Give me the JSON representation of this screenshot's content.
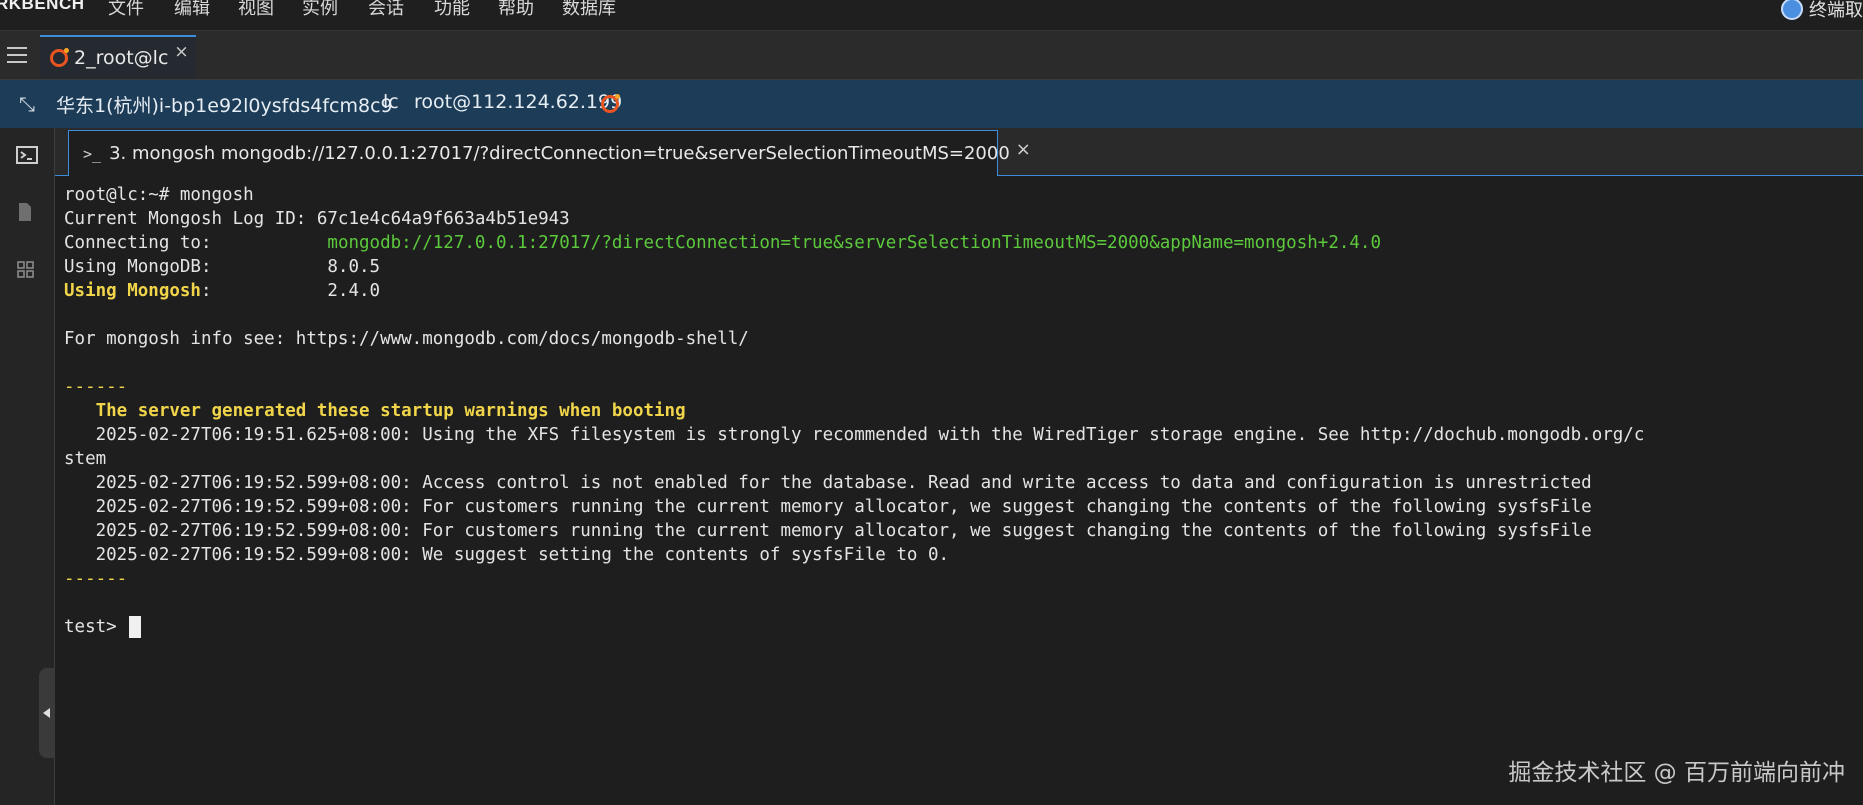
{
  "menubar": {
    "brand": "RKBENCH",
    "items": [
      "文件",
      "编辑",
      "视图",
      "实例",
      "会话",
      "功能",
      "帮助",
      "数据库"
    ],
    "right_label": "终端取"
  },
  "session_tab": {
    "label": "2_root@lc",
    "close": "×"
  },
  "infobar": {
    "instance": "华东1(杭州)i-bp1e92l0ysfds4fcm8c9",
    "host": "lc",
    "user": "root@112.124.62.199"
  },
  "terminal_tab": {
    "prompt_icon": ">_",
    "label": "3. mongosh mongodb://127.0.0.1:27017/?directConnection=true&serverSelectionTimeoutMS=2000",
    "close": "×"
  },
  "terminal": {
    "cmd": "root@lc:~# mongosh",
    "log_id": "Current Mongosh Log ID: 67c1e4c64a9f663a4b51e943",
    "connecting_label": "Connecting to:           ",
    "connecting_value": "mongodb://127.0.0.1:27017/?directConnection=true&serverSelectionTimeoutMS=2000&appName=mongosh+2.4.0",
    "using_mongodb": "Using MongoDB:           8.0.5",
    "using_mongosh_label": "Using Mongosh",
    "using_mongosh_value": ":           2.4.0",
    "info": "For mongosh info see: https://www.mongodb.com/docs/mongodb-shell/",
    "separator": "------",
    "warning_header": "   The server generated these startup warnings when booting",
    "warnings": [
      "   2025-02-27T06:19:51.625+08:00: Using the XFS filesystem is strongly recommended with the WiredTiger storage engine. See http://dochub.mongodb.org/c",
      "stem",
      "   2025-02-27T06:19:52.599+08:00: Access control is not enabled for the database. Read and write access to data and configuration is unrestricted",
      "   2025-02-27T06:19:52.599+08:00: For customers running the current memory allocator, we suggest changing the contents of the following sysfsFile",
      "   2025-02-27T06:19:52.599+08:00: For customers running the current memory allocator, we suggest changing the contents of the following sysfsFile",
      "   2025-02-27T06:19:52.599+08:00: We suggest setting the contents of sysfsFile to 0."
    ],
    "prompt": "test> "
  },
  "watermark": "掘金技术社区 @ 百万前端向前冲"
}
